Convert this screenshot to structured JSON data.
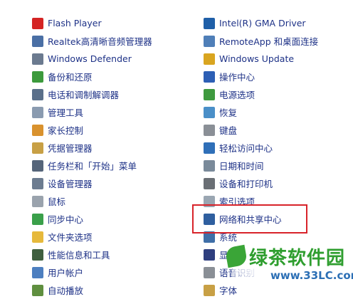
{
  "left_column": [
    {
      "label": "Flash Player",
      "icon": "flash-player-icon",
      "color": "#d42424"
    },
    {
      "label": "Realtek高清晰音频管理器",
      "icon": "realtek-audio-icon",
      "color": "#4a6fa5"
    },
    {
      "label": "Windows Defender",
      "icon": "windows-defender-icon",
      "color": "#6b7a8f"
    },
    {
      "label": "备份和还原",
      "icon": "backup-restore-icon",
      "color": "#3c9a3c"
    },
    {
      "label": "电话和调制解调器",
      "icon": "phone-modem-icon",
      "color": "#5a6f8a"
    },
    {
      "label": "管理工具",
      "icon": "admin-tools-icon",
      "color": "#8a9bb0"
    },
    {
      "label": "家长控制",
      "icon": "parental-controls-icon",
      "color": "#d9922e"
    },
    {
      "label": "凭据管理器",
      "icon": "credential-manager-icon",
      "color": "#c8a045"
    },
    {
      "label": "任务栏和「开始」菜单",
      "icon": "taskbar-start-menu-icon",
      "color": "#55657a"
    },
    {
      "label": "设备管理器",
      "icon": "device-manager-icon",
      "color": "#6c7c90"
    },
    {
      "label": "鼠标",
      "icon": "mouse-icon",
      "color": "#9aa3ad"
    },
    {
      "label": "同步中心",
      "icon": "sync-center-icon",
      "color": "#3aa04a"
    },
    {
      "label": "文件夹选项",
      "icon": "folder-options-icon",
      "color": "#e6b93c"
    },
    {
      "label": "性能信息和工具",
      "icon": "performance-tools-icon",
      "color": "#3f5f3f"
    },
    {
      "label": "用户帐户",
      "icon": "user-accounts-icon",
      "color": "#4d7fc0"
    },
    {
      "label": "自动播放",
      "icon": "autoplay-icon",
      "color": "#5f8f3f"
    }
  ],
  "right_column": [
    {
      "label": "Intel(R) GMA Driver",
      "icon": "intel-gma-icon",
      "color": "#1f5fa8"
    },
    {
      "label": "RemoteApp 和桌面连接",
      "icon": "remoteapp-icon",
      "color": "#4f7fb8"
    },
    {
      "label": "Windows Update",
      "icon": "windows-update-icon",
      "color": "#d9a520"
    },
    {
      "label": "操作中心",
      "icon": "action-center-icon",
      "color": "#2d5fb5"
    },
    {
      "label": "电源选项",
      "icon": "power-options-icon",
      "color": "#3f9a3f"
    },
    {
      "label": "恢复",
      "icon": "recovery-icon",
      "color": "#4a8fc8"
    },
    {
      "label": "键盘",
      "icon": "keyboard-icon",
      "color": "#8a8f96"
    },
    {
      "label": "轻松访问中心",
      "icon": "ease-of-access-icon",
      "color": "#2f6fb8"
    },
    {
      "label": "日期和时间",
      "icon": "date-time-icon",
      "color": "#7a8a9a"
    },
    {
      "label": "设备和打印机",
      "icon": "devices-printers-icon",
      "color": "#6a6f75"
    },
    {
      "label": "索引选项",
      "icon": "indexing-options-icon",
      "color": "#9aa6b2"
    },
    {
      "label": "网络和共享中心",
      "icon": "network-sharing-icon",
      "color": "#2f5f9f"
    },
    {
      "label": "系统",
      "icon": "system-icon",
      "color": "#3f6fa8"
    },
    {
      "label": "显示",
      "icon": "display-icon",
      "color": "#2f3f7f"
    },
    {
      "label": "语音识别",
      "icon": "speech-recognition-icon",
      "color": "#8a8f96"
    },
    {
      "label": "字体",
      "icon": "fonts-icon",
      "color": "#c8a045"
    }
  ],
  "highlight_color": "#d8232a",
  "watermark": {
    "title": "绿茶软件园",
    "url": "www.33LC.com",
    "title_color": "#2f9e2f",
    "url_color": "#2c6fb5"
  }
}
